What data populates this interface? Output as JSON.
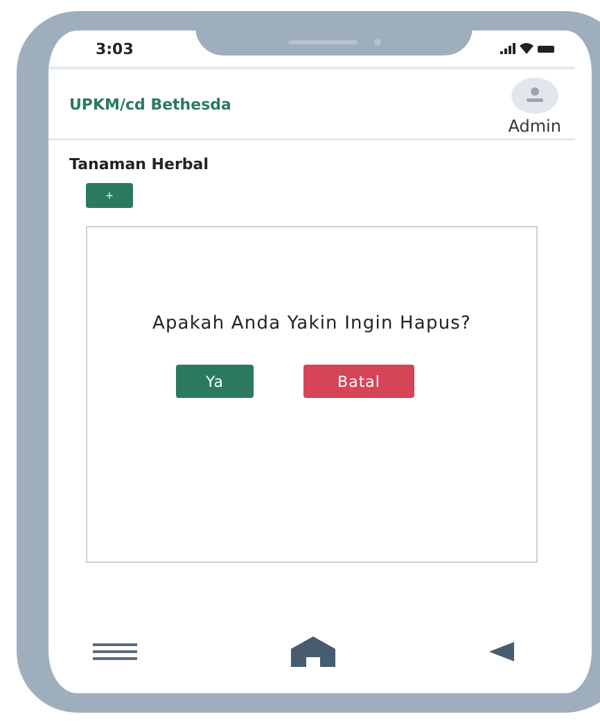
{
  "status_bar": {
    "time": "3:03"
  },
  "header": {
    "title": "UPKM/cd Bethesda",
    "user": "Admin"
  },
  "section": {
    "title": "Tanaman Herbal",
    "add_button": "+"
  },
  "dialog": {
    "message": "Apakah Anda Yakin Ingin Hapus?",
    "buttons": [
      {
        "label": "Ya",
        "kind": "confirm"
      },
      {
        "label": "Batal",
        "kind": "cancel"
      }
    ]
  }
}
